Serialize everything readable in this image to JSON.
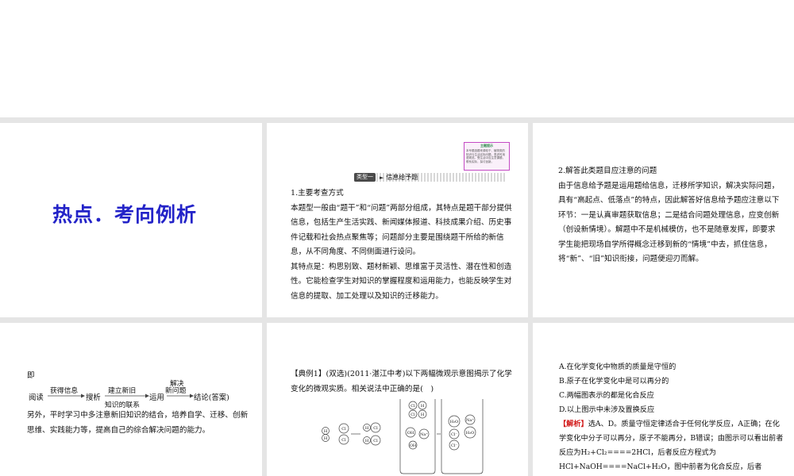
{
  "slide1": {
    "title": "热点．考向例析"
  },
  "slide2": {
    "note_title": "主题提示",
    "note_body": "本专题选题来源较于、植物类的知识与生活实际问题，表述时用语规范。受生活中应注意课题，联系实际，探讨创新。",
    "header_tag": "类型一",
    "header_arrow": "►",
    "header_text": "信息给予题",
    "paragraphs": [
      "1.主要考查方式",
      "本题型一般由“题干”和“问题”两部分组成，其特点是题干部分提供信息，包括生产生活实践、新闻媒体报道、科技成果介绍、历史事件记载和社会热点聚焦等；问题部分主要是围绕题干所给的新信息，从不同角度、不同侧面进行设问。",
      "其特点是：构思别致、题材新颖、思维富于灵活性、潜在性和创造性。它能检查学生对知识的掌握程度和运用能力，也能反映学生对信息的提取、加工处理以及知识的迁移能力。"
    ]
  },
  "slide3": {
    "paragraphs": [
      "2.解答此类题目应注意的问题",
      "由于信息给予题是运用题给信息，迁移所学知识，解决实际问题，具有“高起点、低落点”的特点，因此解答好信息给予题应注意以下环节：一是认真审题获取信息；二是结合问题处理信息，应变创新（创设新情境）。解题中不是机械模仿，也不是随意发挥，即要求学生能把现场自学所得概念迁移到新的“情境”中去，抓住信息，将“新”、“旧”知识衔接，问题便迎刃而解。"
    ]
  },
  "slide4": {
    "ji": "即",
    "flow": {
      "read": "阅读",
      "get_info": "获得信息",
      "search": "搜析",
      "build": "建立新旧",
      "link": "知识的联系",
      "apply": "运用",
      "solve": "解决",
      "new_q": "新问题",
      "conclusion": "结论(答案)"
    },
    "paragraph": "另外，平时学习中多注意新旧知识的结合，培养自学、迁移、创新思维、实践能力等，提高自己的综合解决问题的能力。"
  },
  "slide5": {
    "question": "【典例1】(双选)(2011·湛江中考)以下两幅微观示意图揭示了化学变化的微观实质。相关说法中正确的是(　)",
    "atoms": {
      "h": "H",
      "cl": "Cl",
      "oh": "OH",
      "na": "Na⁺",
      "h2o": "H₂O",
      "na2": "Na⁺",
      "cl_ion": "Cl⁻"
    }
  },
  "slide6": {
    "options": [
      "A.在化学变化中物质的质量是守恒的",
      "B.原子在化学变化中是可以再分的",
      "C.两幅图表示的都是化合反应",
      "D.以上图示中未涉及置换反应"
    ],
    "analysis_label": "【解析】",
    "analysis_text": "选A、D。质量守恒定律适合于任何化学反应，A正确；在化学变化中分子可以再分，原子不能再分，B错误；由图示可以看出前者反应为H₂+Cl₂====2HCl，后者反应方程式为HCl+NaOH====NaCl+H₂O，图中前者为化合反应，后者"
  }
}
